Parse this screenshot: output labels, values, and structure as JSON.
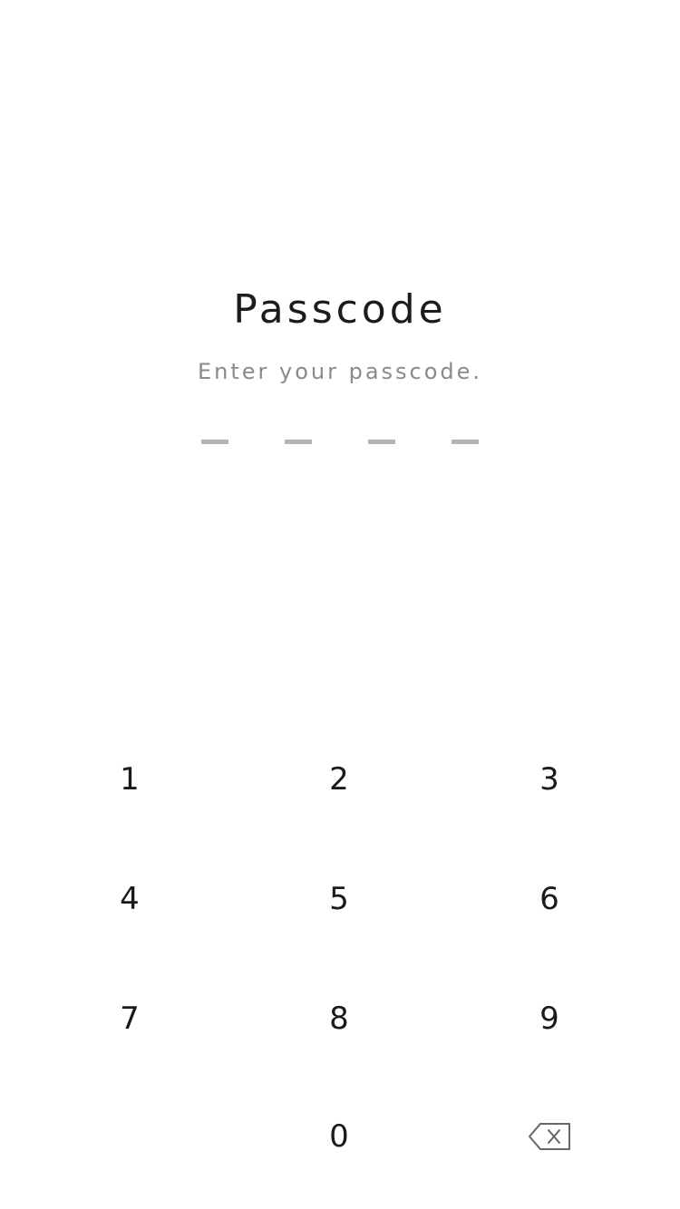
{
  "header": {
    "title": "Passcode",
    "subtitle": "Enter your passcode."
  },
  "passcode": {
    "length": 4,
    "filled": 0
  },
  "keypad": {
    "keys": [
      "1",
      "2",
      "3",
      "4",
      "5",
      "6",
      "7",
      "8",
      "9",
      "0"
    ],
    "backspace_icon": "backspace-icon"
  },
  "colors": {
    "background": "#ffffff",
    "title": "#1c1c1c",
    "subtitle": "#8a8a8a",
    "dash": "#b4b4b4",
    "key_text": "#1a1a1a"
  }
}
